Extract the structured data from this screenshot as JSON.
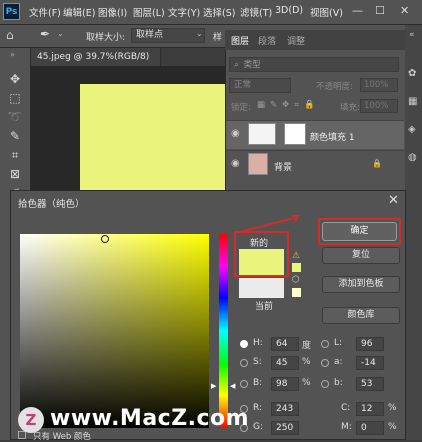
{
  "menubar": {
    "logo": "Ps",
    "items": [
      "文件(F)",
      "编辑(E)",
      "图像(I)",
      "图层(L)",
      "文字(Y)",
      "选择(S)",
      "滤镜(T)",
      "3D(D)",
      "视图(V)"
    ],
    "window_controls": [
      "—",
      "☐",
      "✕"
    ]
  },
  "options": {
    "sample_size_label": "取样大小:",
    "sample_size_value": "取样点",
    "sample_label": "样"
  },
  "document": {
    "tab_label": "45.jpeg @ 39.7%(RGB/8)",
    "tab_close": "×",
    "canvas_color": "#eaf47d"
  },
  "layers_panel": {
    "tabs": [
      "图层",
      "段落",
      "调整"
    ],
    "kind_label": "类型",
    "blend_mode": "正常",
    "opacity_label": "不透明度:",
    "opacity_value": "100%",
    "lock_label": "锁定:",
    "fill_label": "填充:",
    "fill_value": "100%",
    "layers": [
      {
        "name": "颜色填充 1"
      },
      {
        "name": "背景"
      }
    ]
  },
  "color_picker": {
    "title": "拾色器（纯色）",
    "new_label": "新的",
    "current_label": "当前",
    "new_color": "#eaf47d",
    "current_color": "#ececec",
    "buttons": {
      "ok": "确定",
      "reset": "复位",
      "add_swatches": "添加到色板",
      "color_libraries": "颜色库"
    },
    "fields": {
      "H": {
        "label": "H:",
        "value": "64",
        "unit": "度"
      },
      "S": {
        "label": "S:",
        "value": "45",
        "unit": "%"
      },
      "B": {
        "label": "B:",
        "value": "98",
        "unit": "%"
      },
      "R": {
        "label": "R:",
        "value": "243",
        "unit": ""
      },
      "G": {
        "label": "G:",
        "value": "250",
        "unit": ""
      },
      "L": {
        "label": "L:",
        "value": "96",
        "unit": ""
      },
      "a": {
        "label": "a:",
        "value": "-14",
        "unit": ""
      },
      "b": {
        "label": "b:",
        "value": "53",
        "unit": ""
      },
      "C": {
        "label": "C:",
        "value": "12",
        "unit": "%"
      },
      "M": {
        "label": "M:",
        "value": "0",
        "unit": "%"
      }
    },
    "web_colors_label": "只有 Web 颜色"
  },
  "watermark": {
    "badge": "Z",
    "text": "www.MacZ.com"
  },
  "colors": {
    "highlight_red": "#d42b2b",
    "panel_bg": "#535353"
  }
}
